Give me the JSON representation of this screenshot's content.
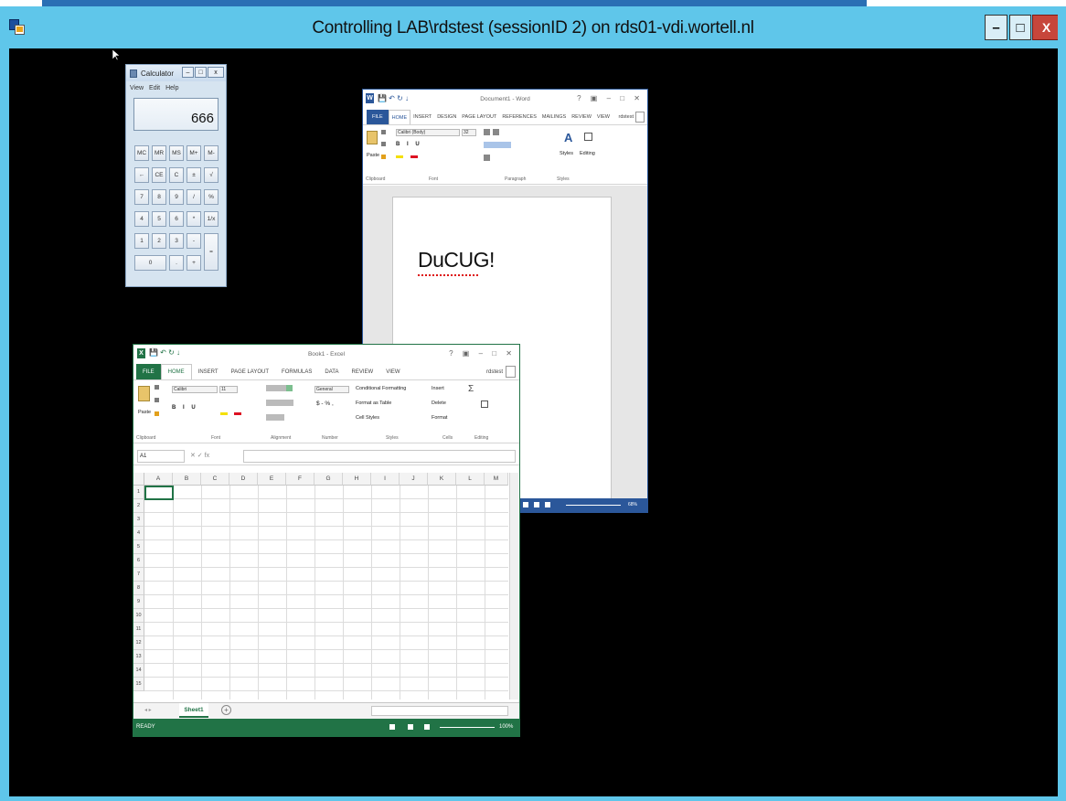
{
  "host": {
    "title": "Controlling LAB\\rdstest (sessionID 2) on rds01-vdi.wortell.nl",
    "btn_min": "–",
    "btn_max": "□",
    "btn_close": "X",
    "frame_color": "#5fc6ea",
    "close_color": "#c7463b"
  },
  "calculator": {
    "title": "Calculator",
    "menu": [
      "View",
      "Edit",
      "Help"
    ],
    "display": "666",
    "buttons": [
      [
        "MC",
        "MR",
        "MS",
        "M+",
        "M-"
      ],
      [
        "←",
        "CE",
        "C",
        "±",
        "√"
      ],
      [
        "7",
        "8",
        "9",
        "/",
        "%"
      ],
      [
        "4",
        "5",
        "6",
        "*",
        "1/x"
      ],
      [
        "1",
        "2",
        "3",
        "-",
        "="
      ],
      [
        "0",
        ".",
        "+"
      ]
    ],
    "ctl_min": "–",
    "ctl_max": "□",
    "ctl_close": "x"
  },
  "word": {
    "app_icon": "W",
    "qat": "💾 ↶ ↻ ↓",
    "doc_title": "Document1 - Word",
    "win_controls": "? ▣ – □ ✕",
    "tabs": [
      "FILE",
      "HOME",
      "INSERT",
      "DESIGN",
      "PAGE LAYOUT",
      "REFERENCES",
      "MAILINGS",
      "REVIEW",
      "VIEW"
    ],
    "active_tab": "HOME",
    "user": "rdstest",
    "font_name": "Calibri (Body)",
    "font_size": "32",
    "paste_label": "Paste",
    "styles_label": "Styles",
    "editing_label": "Editing",
    "group_labels": [
      "Clipboard",
      "Font",
      "Paragraph",
      "Styles"
    ],
    "doc_text": "DuCUG!",
    "zoom": "68%",
    "accent": "#2b579a"
  },
  "excel": {
    "app_icon": "X",
    "qat": "💾 ↶ ↻ ↓",
    "doc_title": "Book1 - Excel",
    "win_controls": "? ▣ – □ ✕",
    "tabs": [
      "FILE",
      "HOME",
      "INSERT",
      "PAGE LAYOUT",
      "FORMULAS",
      "DATA",
      "REVIEW",
      "VIEW"
    ],
    "active_tab": "HOME",
    "user": "rdstest",
    "font_name": "Calibri",
    "font_size": "11",
    "number_format": "General",
    "paste_label": "Paste",
    "cond_format": "Conditional Formatting",
    "format_table": "Format as Table",
    "cell_styles": "Cell Styles",
    "insert": "Insert",
    "delete": "Delete",
    "format": "Format",
    "group_labels": [
      "Clipboard",
      "Font",
      "Alignment",
      "Number",
      "Styles",
      "Cells",
      "Editing"
    ],
    "name_box": "A1",
    "fx": "✕  ✓  fx",
    "columns": [
      "A",
      "B",
      "C",
      "D",
      "E",
      "F",
      "G",
      "H",
      "I",
      "J",
      "K",
      "L",
      "M"
    ],
    "rows": [
      "1",
      "2",
      "3",
      "4",
      "5",
      "6",
      "7",
      "8",
      "9",
      "10",
      "11",
      "12",
      "13",
      "14",
      "15"
    ],
    "sheet_tab": "Sheet1",
    "status_text": "READY",
    "zoom": "100%",
    "accent": "#217346"
  }
}
